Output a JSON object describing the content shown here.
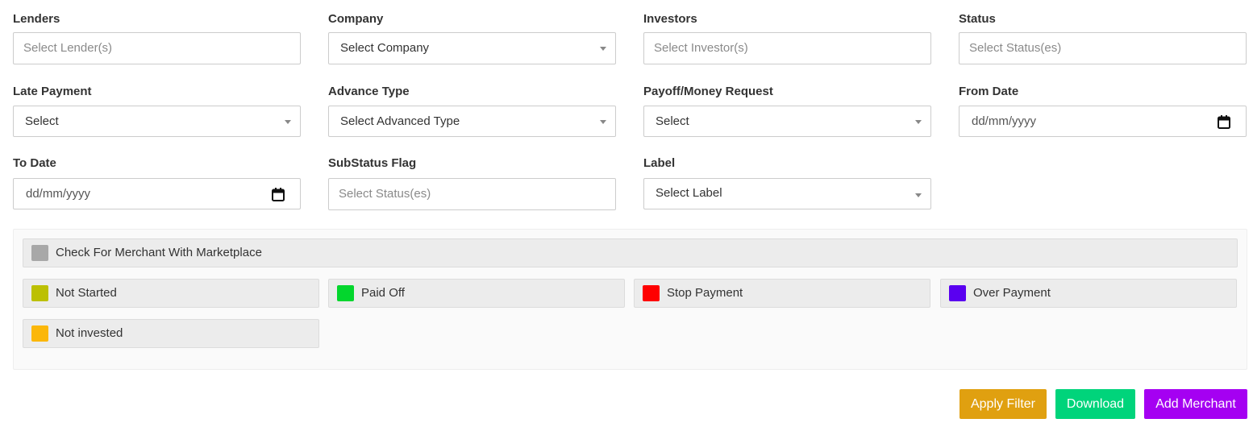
{
  "filters": {
    "lenders": {
      "label": "Lenders",
      "placeholder": "Select Lender(s)"
    },
    "company": {
      "label": "Company",
      "value": "Select Company"
    },
    "investors": {
      "label": "Investors",
      "placeholder": "Select Investor(s)"
    },
    "status": {
      "label": "Status",
      "placeholder": "Select Status(es)"
    },
    "late_payment": {
      "label": "Late Payment",
      "value": "Select"
    },
    "advance_type": {
      "label": "Advance Type",
      "value": "Select Advanced Type"
    },
    "payoff_request": {
      "label": "Payoff/Money Request",
      "value": "Select"
    },
    "from_date": {
      "label": "From Date",
      "value": "dd/mm/yyyy"
    },
    "to_date": {
      "label": "To Date",
      "value": "dd/mm/yyyy"
    },
    "substatus_flag": {
      "label": "SubStatus Flag",
      "placeholder": "Select Status(es)"
    },
    "label": {
      "label": "Label",
      "value": "Select Label"
    }
  },
  "legend": {
    "marketplace": {
      "label": "Check For Merchant With Marketplace",
      "color": "#a8a8a8"
    },
    "items": [
      {
        "label": "Not Started",
        "color": "#bcc003"
      },
      {
        "label": "Paid Off",
        "color": "#03d62d"
      },
      {
        "label": "Stop Payment",
        "color": "#fe0000"
      },
      {
        "label": "Over Payment",
        "color": "#5a00f0"
      },
      {
        "label": "Not invested",
        "color": "#fbb70a"
      }
    ]
  },
  "actions": {
    "apply_filter": {
      "label": "Apply Filter",
      "color": "#e0a010"
    },
    "download": {
      "label": "Download",
      "color": "#00d47b"
    },
    "add_merchant": {
      "label": "Add Merchant",
      "color": "#a500f2"
    }
  }
}
